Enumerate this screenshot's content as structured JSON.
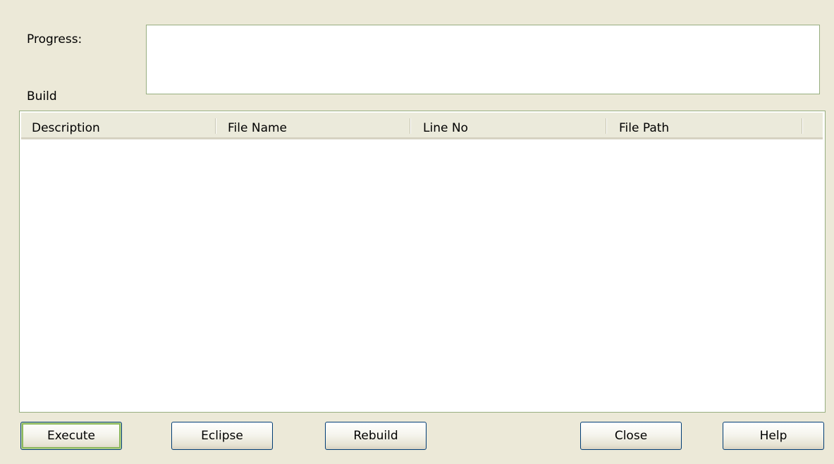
{
  "progress": {
    "label": "Progress:",
    "value": ""
  },
  "build": {
    "label": "Build",
    "columns": [
      "Description",
      "File Name",
      "Line No",
      "File Path"
    ],
    "rows": []
  },
  "buttons": {
    "execute": "Execute",
    "eclipse": "Eclipse",
    "rebuild": "Rebuild",
    "close": "Close",
    "help": "Help"
  },
  "colors": {
    "dialog_background": "#ECE9D8",
    "field_border": "#97AE80",
    "default_button_highlight": "#8CB85B"
  }
}
